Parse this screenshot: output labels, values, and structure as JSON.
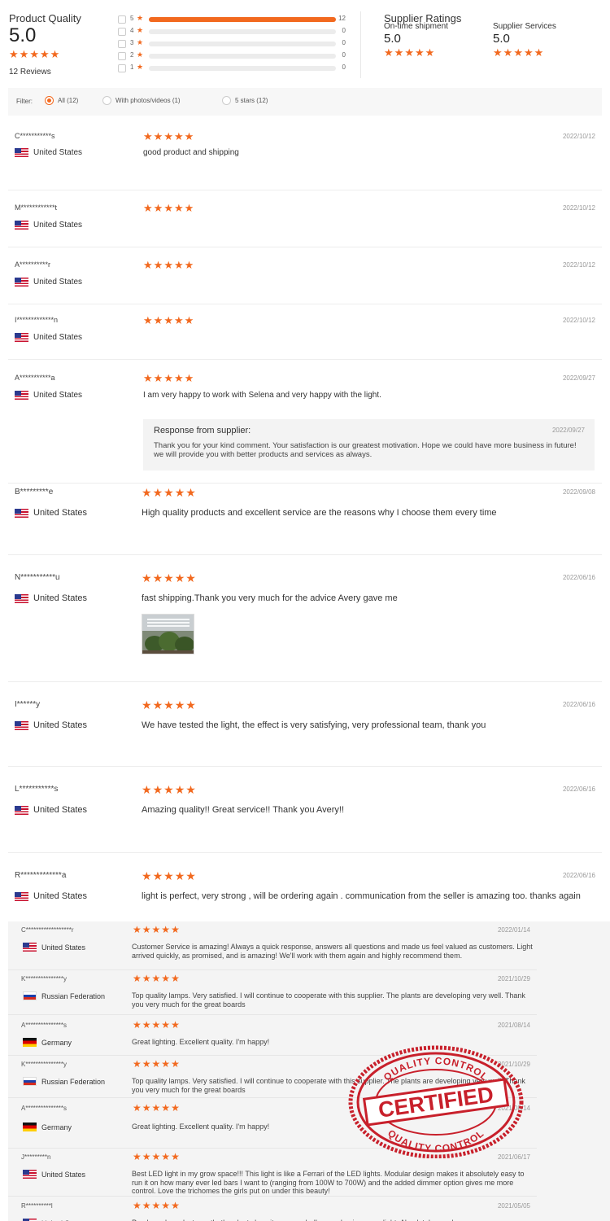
{
  "summary": {
    "product_quality_title": "Product Quality",
    "product_quality_score": "5.0",
    "review_count": "12 Reviews",
    "distribution": [
      {
        "stars": "5",
        "count": "12",
        "fraction": 1.0
      },
      {
        "stars": "4",
        "count": "0",
        "fraction": 0
      },
      {
        "stars": "3",
        "count": "0",
        "fraction": 0
      },
      {
        "stars": "2",
        "count": "0",
        "fraction": 0
      },
      {
        "stars": "1",
        "count": "0",
        "fraction": 0
      }
    ],
    "supplier_ratings_title": "Supplier Ratings",
    "ontime_label": "On-time shipment",
    "ontime_score": "5.0",
    "services_label": "Supplier Services",
    "services_score": "5.0"
  },
  "filter": {
    "label": "Filter:",
    "options": [
      "All (12)",
      "With photos/videos (1)",
      "5 stars (12)"
    ],
    "selected": "All (12)"
  },
  "reviews": [
    {
      "name": "C***********s",
      "country": "United States",
      "date": "2022/10/12",
      "rating": 5,
      "text": "good product and shipping"
    },
    {
      "name": "M************t",
      "country": "United States",
      "date": "2022/10/12",
      "rating": 5,
      "text": ""
    },
    {
      "name": "A**********r",
      "country": "United States",
      "date": "2022/10/12",
      "rating": 5,
      "text": ""
    },
    {
      "name": "I*************n",
      "country": "United States",
      "date": "2022/10/12",
      "rating": 5,
      "text": ""
    },
    {
      "name": "A***********a",
      "country": "United States",
      "date": "2022/09/27",
      "rating": 5,
      "text": "I am very happy to work with Selena and very happy with the light."
    },
    {
      "name": "B*********e",
      "country": "United States",
      "date": "2022/09/08",
      "rating": 5,
      "text": "High quality products and excellent service are the reasons why I choose them every time"
    },
    {
      "name": "N***********u",
      "country": "United States",
      "date": "2022/06/16",
      "rating": 5,
      "text": "fast shipping.Thank you very much for the advice Avery gave me"
    },
    {
      "name": "I******y",
      "country": "United States",
      "date": "2022/06/16",
      "rating": 5,
      "text": "We have tested the light, the effect is very satisfying, very professional team, thank you"
    },
    {
      "name": "L***********s",
      "country": "United States",
      "date": "2022/06/16",
      "rating": 5,
      "text": "Amazing quality!! Great service!! Thank you Avery!!"
    },
    {
      "name": "R*************a",
      "country": "United States",
      "date": "2022/06/16",
      "rating": 5,
      "text": "light is perfect, very strong , will be ordering again . communication from the seller is amazing too. thanks again"
    }
  ],
  "response": {
    "title": "Response from supplier:",
    "date": "2022/09/27",
    "text": "Thank you for your kind comment. Your satisfaction is our greatest motivation. Hope we could have more business in future! we will provide you with better products and services as always."
  },
  "photo": {
    "icon": "grow-light-photo"
  },
  "older_reviews": [
    {
      "name": "C******************r",
      "country": "United States",
      "date": "2022/01/14",
      "rating": 5,
      "text": "Customer Service is amazing! Always a quick response, answers all questions and made us feel valued as customers. Light arrived quickly, as promised, and is amazing! We'll work with them again and highly recommend them."
    },
    {
      "name": "K***************y",
      "country": "Russian Federation",
      "date": "2021/10/29",
      "rating": 5,
      "text": "Top quality lamps. Very satisfied. I will continue to cooperate with this supplier. The plants are developing very well. Thank you very much for the great boards"
    },
    {
      "name": "A***************s",
      "country": "Germany",
      "date": "2021/08/14",
      "rating": 5,
      "text": "Great lighting. Excellent quality. I'm happy!"
    },
    {
      "name": "K***************y",
      "country": "Russian Federation",
      "date": "2021/10/29",
      "rating": 5,
      "text": "Top quality lamps. Very satisfied. I will continue to cooperate with this supplier. The plants are developing very well. Thank you very much for the great boards"
    },
    {
      "name": "A***************s",
      "country": "Germany",
      "date": "2021/08/14",
      "rating": 5,
      "text": "Great lighting. Excellent quality. I'm happy!"
    },
    {
      "name": "J*********n",
      "country": "United States",
      "date": "2021/06/17",
      "rating": 5,
      "text": "Best LED light in my grow space!!! This light is like a Ferrari of the LED lights. Modular design makes it absolutely easy to run it on how many ever led bars I want to (ranging from 100W to 700W) and the added dimmer option gives me more control. Love the trichomes the girls put on under this beauty!"
    },
    {
      "name": "R**********l",
      "country": "United States",
      "date": "2021/05/05",
      "rating": 5,
      "text": "Purchased one last month, the plants love it very much. I'm now buying more light. Absolutely wonder"
    }
  ],
  "seal": {
    "top_text": "QUALITY CONTROL",
    "main_text": "CERTIFIED",
    "bottom_text": "QUALITY CONTROL",
    "color": "#c8202b"
  },
  "colors": {
    "accent": "#f2691f",
    "text": "#333333",
    "muted": "#999999"
  }
}
